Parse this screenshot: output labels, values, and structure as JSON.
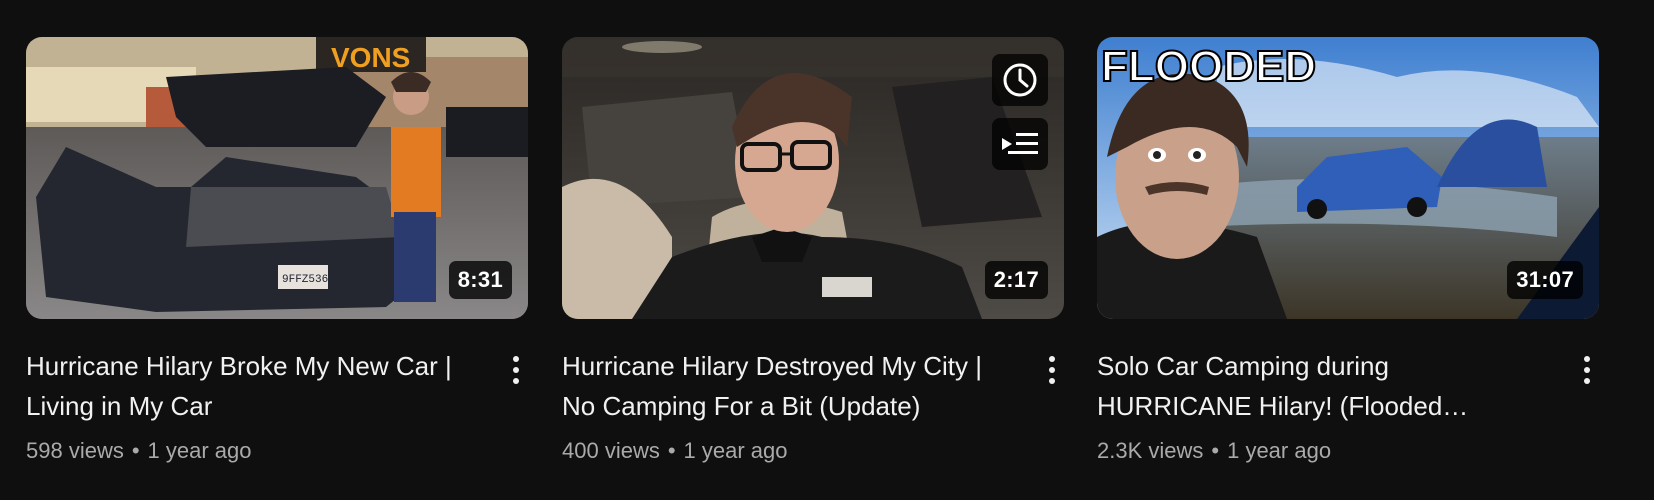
{
  "videos": [
    {
      "title_line1": "Hurricane Hilary Broke My New Car |",
      "title_line2": "Living in My Car",
      "duration": "8:31",
      "views": "598 views",
      "separator": "•",
      "age": "1 year ago",
      "thumbnail_sign_text": "VONS",
      "plate_text": "9FFZ536"
    },
    {
      "title_line1": "Hurricane Hilary Destroyed My City |",
      "title_line2": "No Camping For a Bit (Update)",
      "duration": "2:17",
      "views": "400 views",
      "separator": "•",
      "age": "1 year ago",
      "hover_icons": [
        "clock-icon",
        "add-to-queue-icon"
      ]
    },
    {
      "title_line1": "Solo Car Camping during",
      "title_line2": "HURRICANE Hilary! (Flooded…",
      "duration": "31:07",
      "views": "2.3K views",
      "separator": "•",
      "age": "1 year ago",
      "thumbnail_overlay_text": "FLOODED"
    }
  ],
  "colors": {
    "background": "#0f0f0f",
    "title": "#f1f1f1",
    "meta": "#aaaaaa",
    "sign_orange": "#f0a020"
  },
  "icons": {
    "menu": "more-vert-icon"
  }
}
